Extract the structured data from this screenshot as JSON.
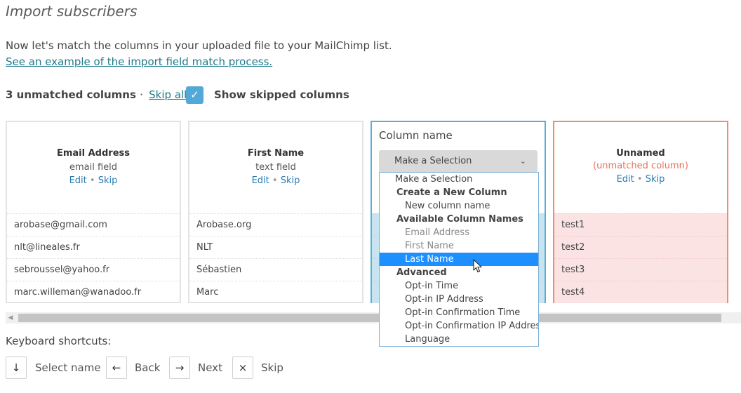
{
  "page": {
    "title": "Import subscribers",
    "intro": "Now let's match the columns in your uploaded file to your MailChimp list.",
    "example_link": "See an example of the import field match process."
  },
  "toolbar": {
    "unmatched_text": "3 unmatched columns",
    "separator": "·",
    "skip_all": "Skip all",
    "show_skipped_label": "Show skipped columns",
    "show_skipped_checked": true,
    "checkmark_glyph": "✓"
  },
  "columns": [
    {
      "name": "Email Address",
      "type": "email field",
      "edit": "Edit",
      "dot": "•",
      "skip": "Skip",
      "rows": [
        "arobase@gmail.com",
        "nlt@lineales.fr",
        "sebroussel@yahoo.fr",
        "marc.willeman@wanadoo.fr"
      ]
    },
    {
      "name": "First Name",
      "type": "text field",
      "edit": "Edit",
      "dot": "•",
      "skip": "Skip",
      "rows": [
        "Arobase.org",
        "NLT",
        "Sébastien",
        "Marc"
      ]
    },
    {
      "label": "Column name",
      "select_value": "Make a Selection",
      "caret_icon": "chevron-down-icon",
      "caret_glyph": "⌄",
      "rows": [
        "",
        "",
        "",
        ""
      ]
    },
    {
      "name": "Unnamed",
      "type": "(unmatched column)",
      "edit": "Edit",
      "dot": "•",
      "skip": "Skip",
      "rows": [
        "test1",
        "test2",
        "test3",
        "test4"
      ]
    }
  ],
  "dropdown": {
    "items": [
      {
        "label": "Make a Selection",
        "kind": "option"
      },
      {
        "label": "Create a New Column",
        "kind": "group"
      },
      {
        "label": "New column name",
        "kind": "suboption"
      },
      {
        "label": "Available Column Names",
        "kind": "group"
      },
      {
        "label": "Email Address",
        "kind": "suboption",
        "disabled": true
      },
      {
        "label": "First Name",
        "kind": "suboption",
        "disabled": true
      },
      {
        "label": "Last Name",
        "kind": "suboption",
        "highlighted": true
      },
      {
        "label": "Advanced",
        "kind": "group"
      },
      {
        "label": "Opt-in Time",
        "kind": "suboption"
      },
      {
        "label": "Opt-in IP Address",
        "kind": "suboption"
      },
      {
        "label": "Opt-in Confirmation Time",
        "kind": "suboption"
      },
      {
        "label": "Opt-in Confirmation IP Address",
        "kind": "suboption"
      },
      {
        "label": "Language",
        "kind": "suboption"
      }
    ]
  },
  "scrollbar": {
    "left_arrow_glyph": "◀"
  },
  "shortcuts": {
    "title": "Keyboard shortcuts:",
    "keys": [
      {
        "glyph": "↓",
        "label": "Select name",
        "icon": "arrow-down-icon"
      },
      {
        "glyph": "←",
        "label": "Back",
        "icon": "arrow-left-icon"
      },
      {
        "glyph": "→",
        "label": "Next",
        "icon": "arrow-right-icon"
      },
      {
        "glyph": "×",
        "label": "Skip",
        "icon": "close-icon"
      }
    ]
  },
  "colors": {
    "accent": "#52a8d6",
    "link": "#2a7bb0",
    "unmatched": "#e8715a",
    "highlight": "#1e8fff"
  }
}
